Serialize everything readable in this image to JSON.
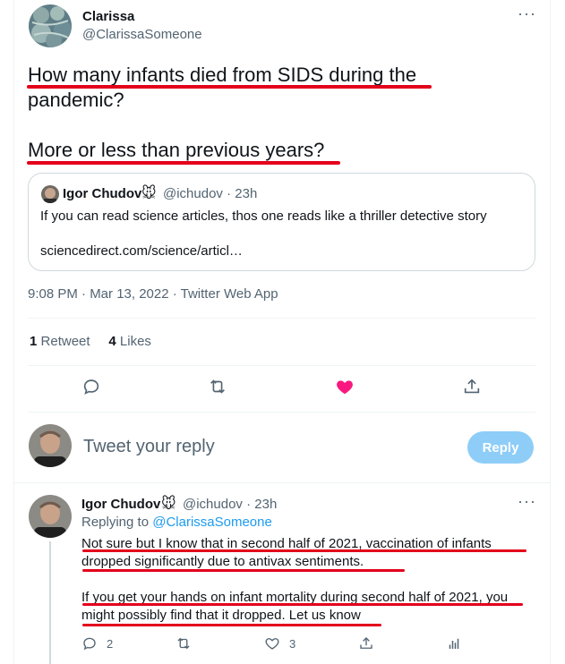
{
  "main_tweet": {
    "author_name": "Clarissa",
    "author_handle": "@ClarissaSomeone",
    "text_line1": "How many infants died from SIDS during the",
    "text_line2": "pandemic?",
    "text_line3": "More or less than previous years?",
    "timestamp": "9:08 PM · Mar 13, 2022 · Twitter Web App",
    "retweet_count": "1",
    "retweet_label": "Retweet",
    "like_count": "4",
    "like_label": "Likes"
  },
  "quoted_tweet": {
    "author_name": "Igor Chudov",
    "author_emoji": "🐭",
    "meta": "@ichudov · 23h",
    "text": "If you can read science articles, thos one reads like a thriller detective story",
    "link": "sciencedirect.com/science/articl…"
  },
  "compose": {
    "placeholder": "Tweet your reply",
    "reply_button": "Reply"
  },
  "reply_tweet": {
    "author_name": "Igor Chudov",
    "author_emoji": "🐭",
    "meta": "@ichudov · 23h",
    "replying_prefix": "Replying to",
    "replying_handle": "@ClarissaSomeone",
    "para1_line1": "Not sure but I know that in second half of 2021, vaccination of infants",
    "para1_line2": "dropped significantly due to antivax sentiments.",
    "para2_line1": "If you get your hands on infant mortality during second half of 2021, you",
    "para2_line2": "might possibly find that it dropped. Let us know",
    "reply_count": "2",
    "like_count": "3"
  },
  "icons": {
    "reply": "reply-icon",
    "retweet": "retweet-icon",
    "like": "heart-icon",
    "share": "share-icon",
    "analytics": "analytics-icon",
    "more": "more-icon"
  },
  "colors": {
    "accent": "#1d9bf0",
    "like_active": "#f91880",
    "annotation_red": "#e3001b",
    "reply_button_disabled": "#8ecdf8"
  }
}
